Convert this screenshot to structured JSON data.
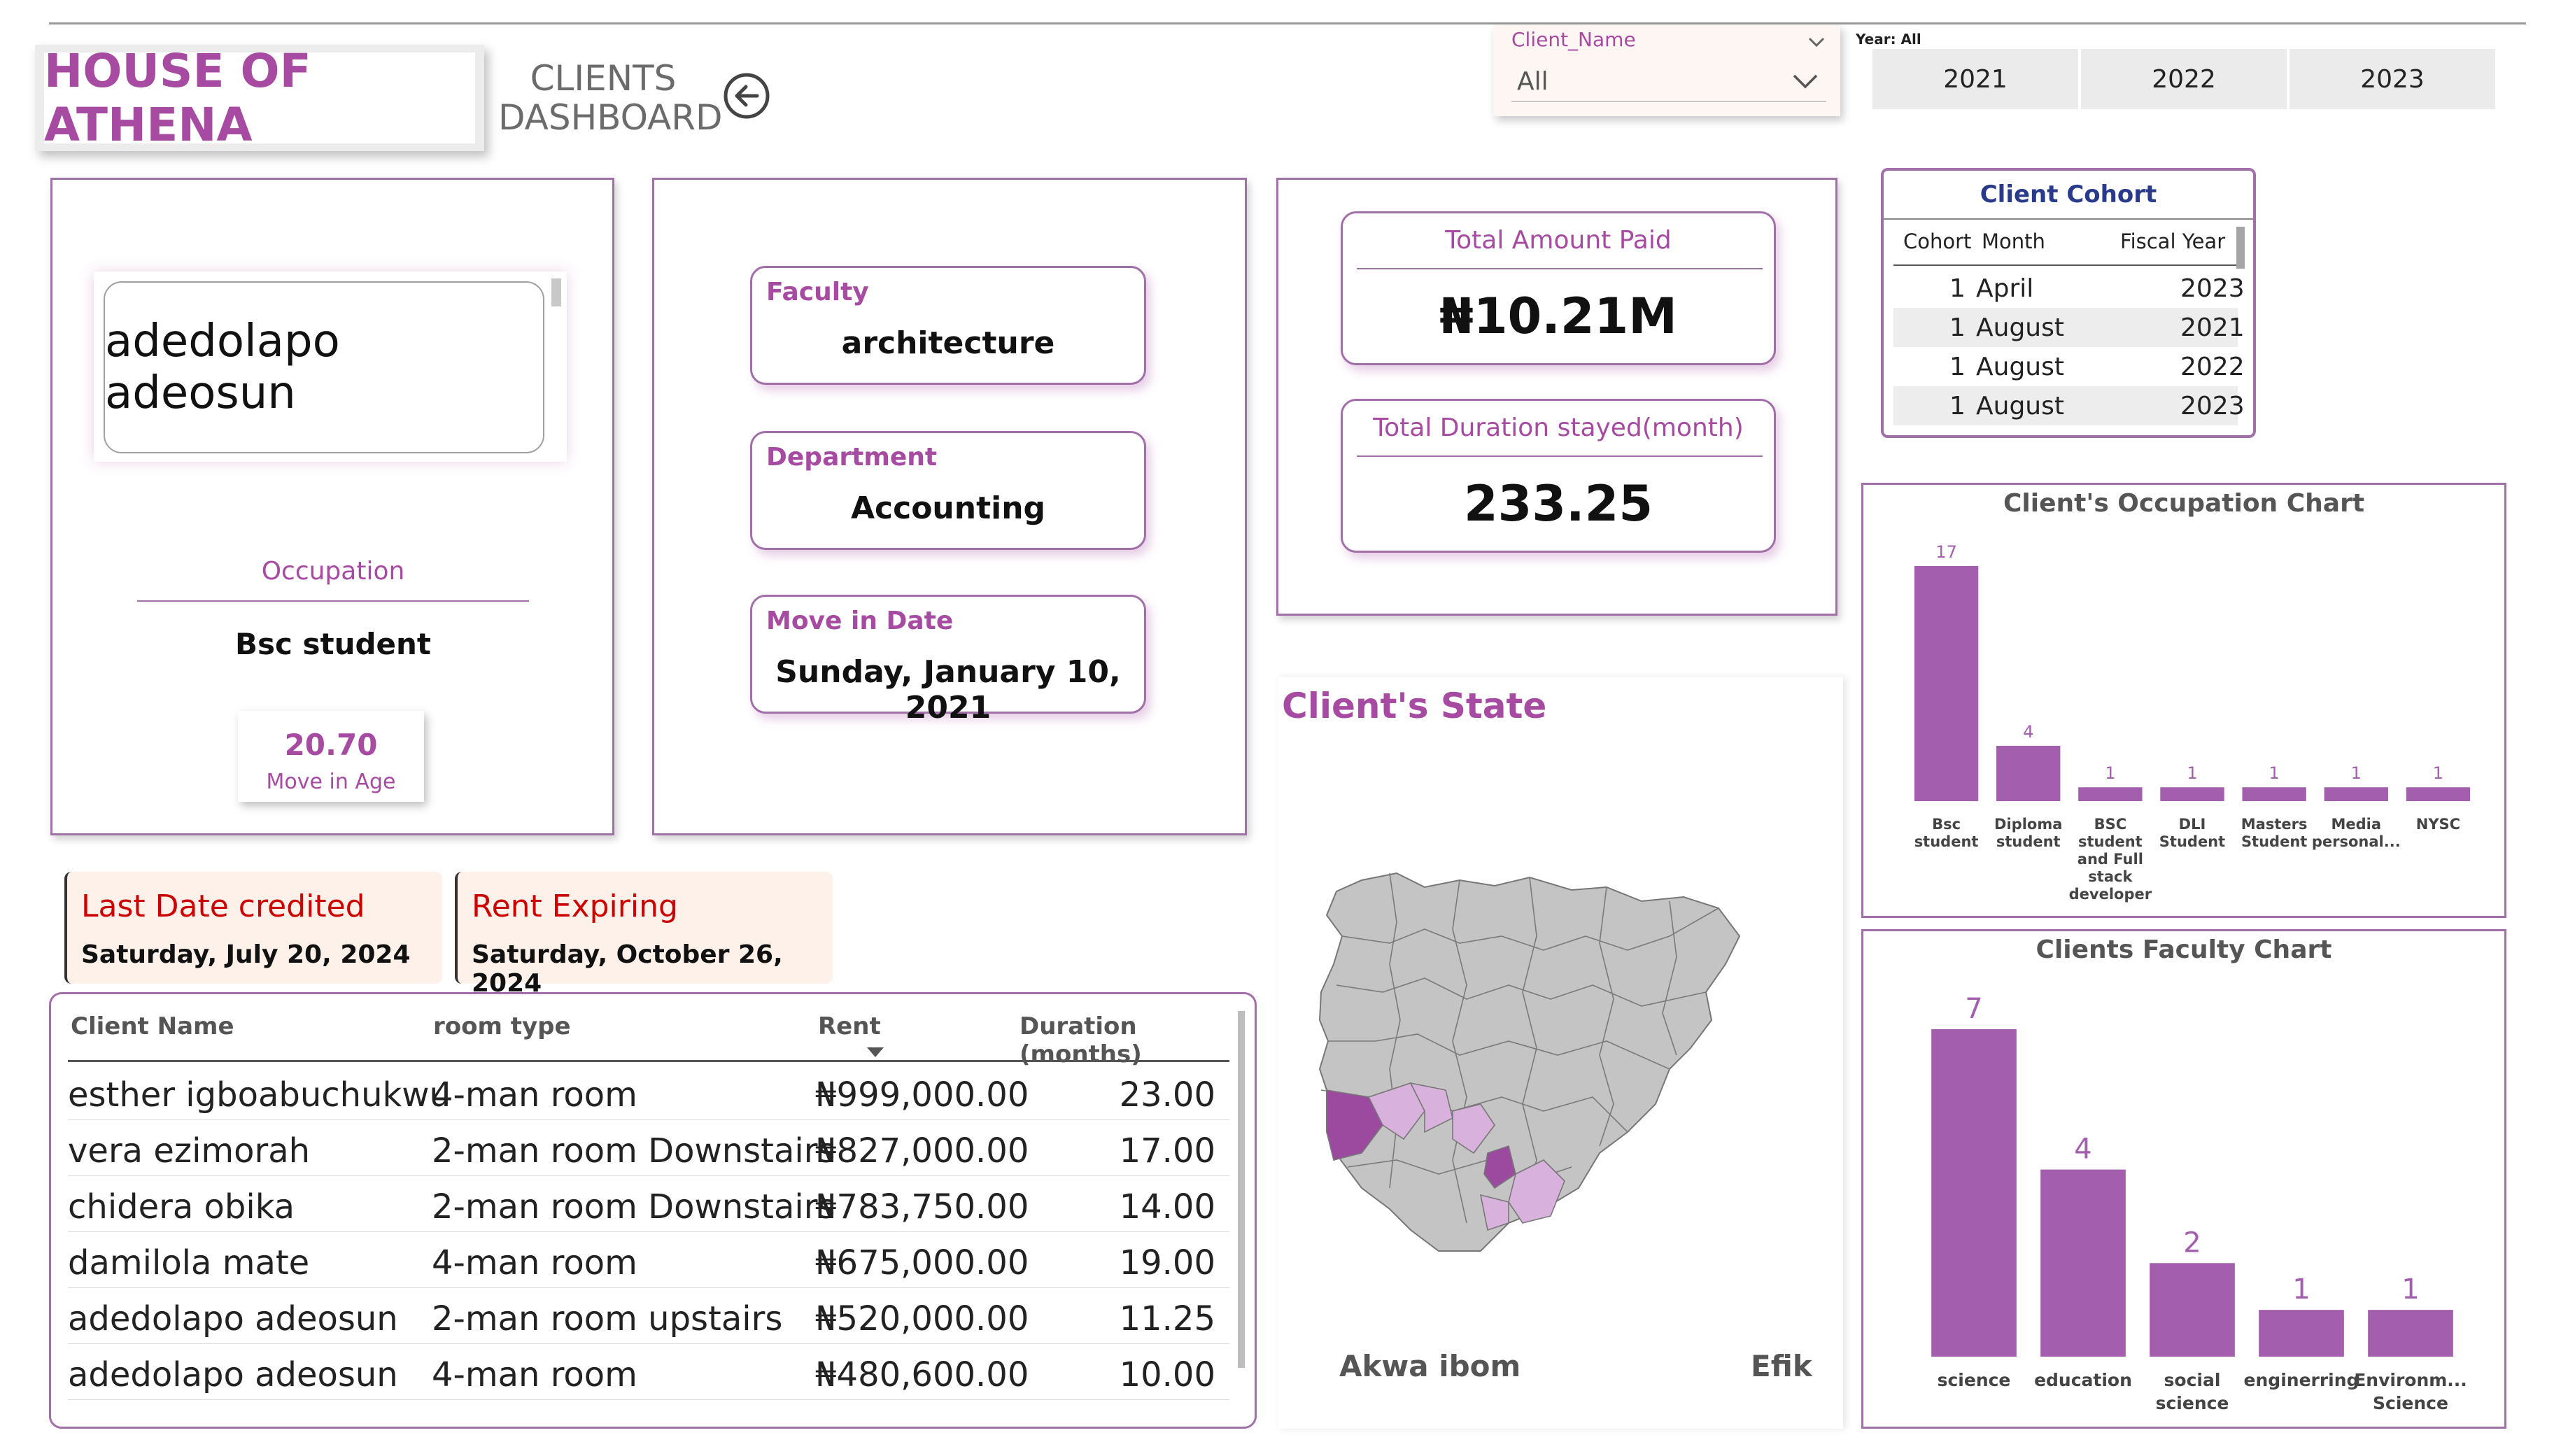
{
  "brand": {
    "title": "HOUSE OF ATHENA"
  },
  "header": {
    "line1": "CLIENTS",
    "line2": "DASHBOARD"
  },
  "slicer": {
    "label": "Client_Name",
    "value": "All"
  },
  "year_filter": {
    "label": "Year: All",
    "options": [
      "2021",
      "2022",
      "2023"
    ]
  },
  "client": {
    "name": "adedolapo adeosun",
    "occupation_label": "Occupation",
    "occupation": "Bsc student",
    "age_value": "20.70",
    "age_label": "Move in Age",
    "faculty_label": "Faculty",
    "faculty": "architecture",
    "department_label": "Department",
    "department": "Accounting",
    "move_in_label": "Move in Date",
    "move_in": "Sunday, January 10, 2021"
  },
  "kpis": {
    "paid_label": "Total Amount Paid",
    "paid_value": "₦10.21M",
    "duration_label": "Total Duration stayed(month)",
    "duration_value": "233.25"
  },
  "cohort": {
    "title": "Client Cohort",
    "headers": [
      "Cohort",
      "Month",
      "Fiscal Year"
    ],
    "rows": [
      {
        "cohort": "1",
        "month": "April",
        "year": "2023"
      },
      {
        "cohort": "1",
        "month": "August",
        "year": "2021"
      },
      {
        "cohort": "1",
        "month": "August",
        "year": "2022"
      },
      {
        "cohort": "1",
        "month": "August",
        "year": "2023"
      }
    ]
  },
  "credit": {
    "last_label": "Last Date credited",
    "last_value": "Saturday, July 20, 2024",
    "expire_label": "Rent Expiring",
    "expire_value": "Saturday, October 26, 2024"
  },
  "table": {
    "headers": [
      "Client Name",
      "room type",
      "Rent",
      "Duration (months)"
    ],
    "rows": [
      [
        "esther igboabuchukwu",
        "4-man room",
        "₦999,000.00",
        "23.00"
      ],
      [
        "vera ezimorah",
        "2-man room Downstairs",
        "₦827,000.00",
        "17.00"
      ],
      [
        "chidera obika",
        "2-man room Downstairs",
        "₦783,750.00",
        "14.00"
      ],
      [
        "damilola mate",
        "4-man room",
        "₦675,000.00",
        "19.00"
      ],
      [
        "adedolapo adeosun",
        "2-man room upstairs",
        "₦520,000.00",
        "11.25"
      ],
      [
        "adedolapo adeosun",
        "4-man room",
        "₦480,600.00",
        "10.00"
      ]
    ]
  },
  "map": {
    "title": "Client's State",
    "state": "Akwa ibom",
    "tribe": "Efik"
  },
  "colors": {
    "accent": "#a64ba1",
    "bar": "#a35fad",
    "map_base": "#c4c4c4",
    "map_dark": "#9b4aa0",
    "map_light": "#d8b2dc"
  },
  "chart_data": [
    {
      "type": "bar",
      "title": "Client's Occupation Chart",
      "categories": [
        "Bsc student",
        "Diploma student",
        "BSC student and Full stack developer",
        "DLI Student",
        "Masters Student",
        "Media personal...",
        "NYSC"
      ],
      "category_lines": [
        [
          "Bsc",
          "student"
        ],
        [
          "Diploma",
          "student"
        ],
        [
          "BSC",
          "student",
          "and Full",
          "stack",
          "developer"
        ],
        [
          "DLI",
          "Student"
        ],
        [
          "Masters",
          "Student"
        ],
        [
          "Media",
          "personal..."
        ],
        [
          "NYSC"
        ]
      ],
      "values": [
        17,
        4,
        1,
        1,
        1,
        1,
        1
      ],
      "ylim": [
        0,
        17
      ]
    },
    {
      "type": "bar",
      "title": "Clients Faculty Chart",
      "categories": [
        "science",
        "education",
        "social science",
        "enginerring",
        "Environm... Science"
      ],
      "category_lines": [
        [
          "science"
        ],
        [
          "education"
        ],
        [
          "social",
          "science"
        ],
        [
          "enginerring"
        ],
        [
          "Environm...",
          "Science"
        ]
      ],
      "values": [
        7,
        4,
        2,
        1,
        1
      ],
      "ylim": [
        0,
        7
      ]
    }
  ]
}
